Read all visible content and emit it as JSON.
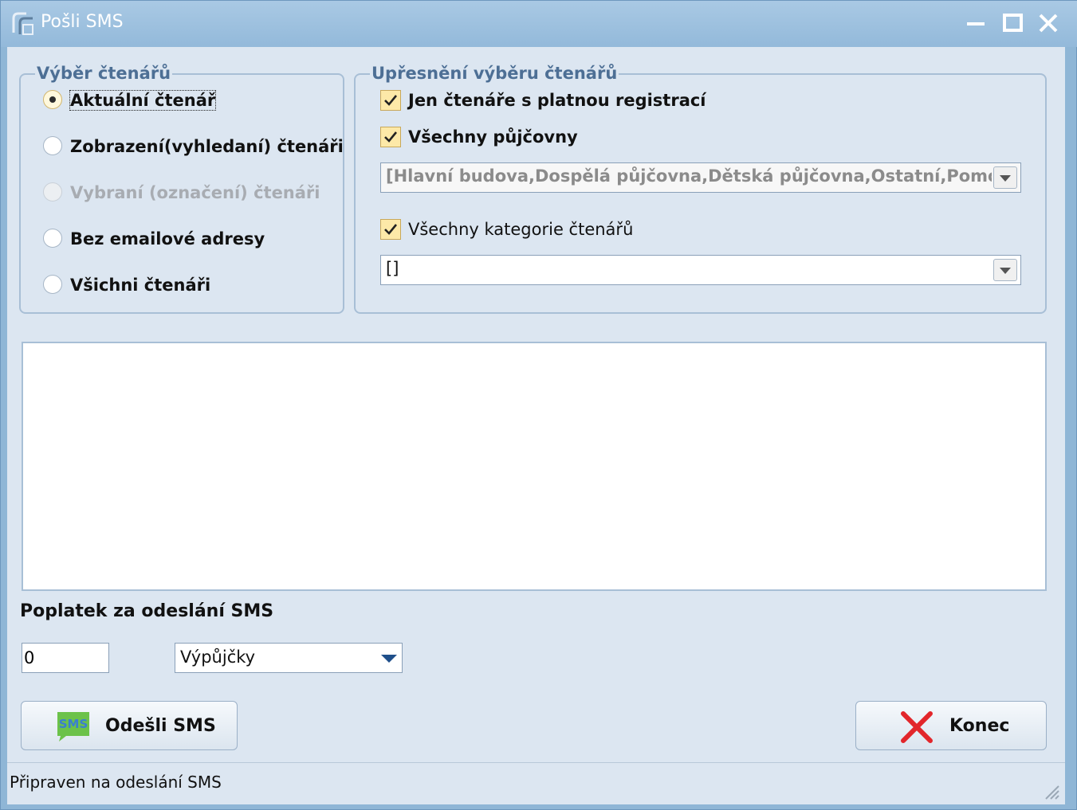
{
  "window": {
    "title": "Pošli SMS"
  },
  "reader_selection": {
    "legend": "Výběr čtenářů",
    "options": [
      {
        "label": "Aktuální čtenář",
        "checked": true,
        "disabled": false
      },
      {
        "label": "Zobrazení(vyhledaní) čtenáři",
        "checked": false,
        "disabled": false
      },
      {
        "label": "Vybraní (označení) čtenáři",
        "checked": false,
        "disabled": true
      },
      {
        "label": "Bez emailové adresy",
        "checked": false,
        "disabled": false
      },
      {
        "label": "Všichni čtenáři",
        "checked": false,
        "disabled": false
      }
    ]
  },
  "refine": {
    "legend": "Upřesnění výběru čtenářů",
    "valid_registration_label": "Jen čtenáře s platnou registrací",
    "all_branches_label": "Všechny půjčovny",
    "branches_value": "[Hlavní budova,Dospělá půjčovna,Dětská půjčovna,Ostatní,Pomocn",
    "all_categories_label": "Všechny kategorie čtenářů",
    "categories_value": "[]"
  },
  "message": {
    "text": ""
  },
  "fee": {
    "label": "Poplatek za odeslání SMS",
    "amount": "0",
    "type": "Výpůjčky"
  },
  "buttons": {
    "send_label": "Odešli SMS",
    "sms_icon_text": "SMS",
    "close_label": "Konec"
  },
  "status": {
    "text": "Připraven na odeslání SMS"
  },
  "colors": {
    "titlebar": "#93b9da",
    "client": "#dce6f1",
    "legend": "#4d6f95",
    "close_x": "#e2262b"
  }
}
